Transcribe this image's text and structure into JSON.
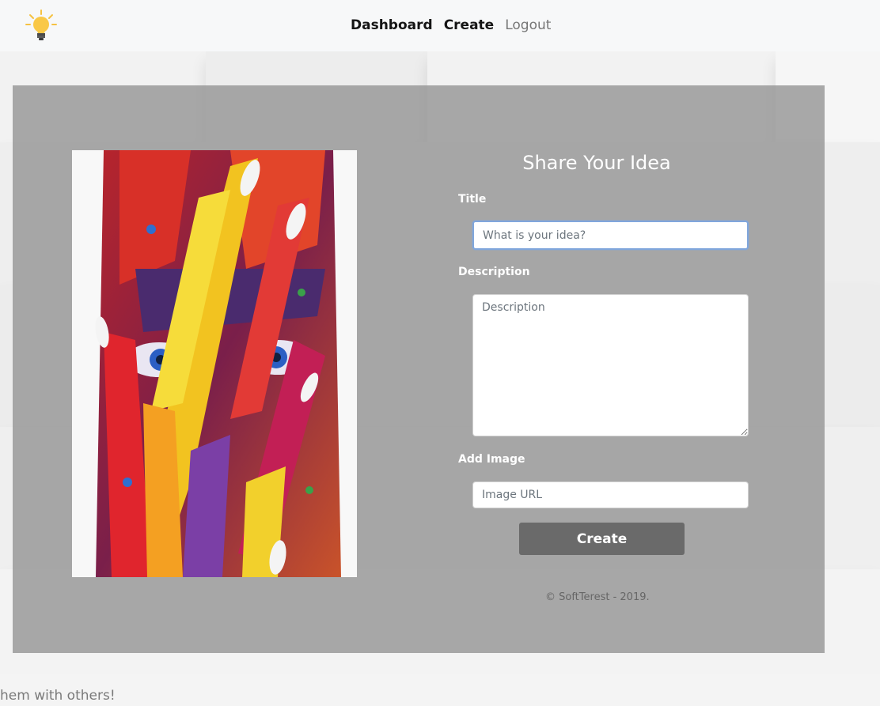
{
  "nav": {
    "logo_icon": "lightbulb-icon",
    "links": [
      "Dashboard",
      "Create",
      "Logout"
    ]
  },
  "form": {
    "title": "Share Your Idea",
    "title_label": "Title",
    "title_placeholder": "What is your idea?",
    "description_label": "Description",
    "description_placeholder": "Description",
    "image_label": "Add Image",
    "image_placeholder": "Image URL",
    "submit_label": "Create"
  },
  "footer": {
    "copyright": "© SoftTerest - 2019.",
    "tagline": "hem with others!"
  },
  "colors": {
    "panel": "#969696",
    "button": "#6a6a6a",
    "focus_ring": "#80a6dc"
  }
}
